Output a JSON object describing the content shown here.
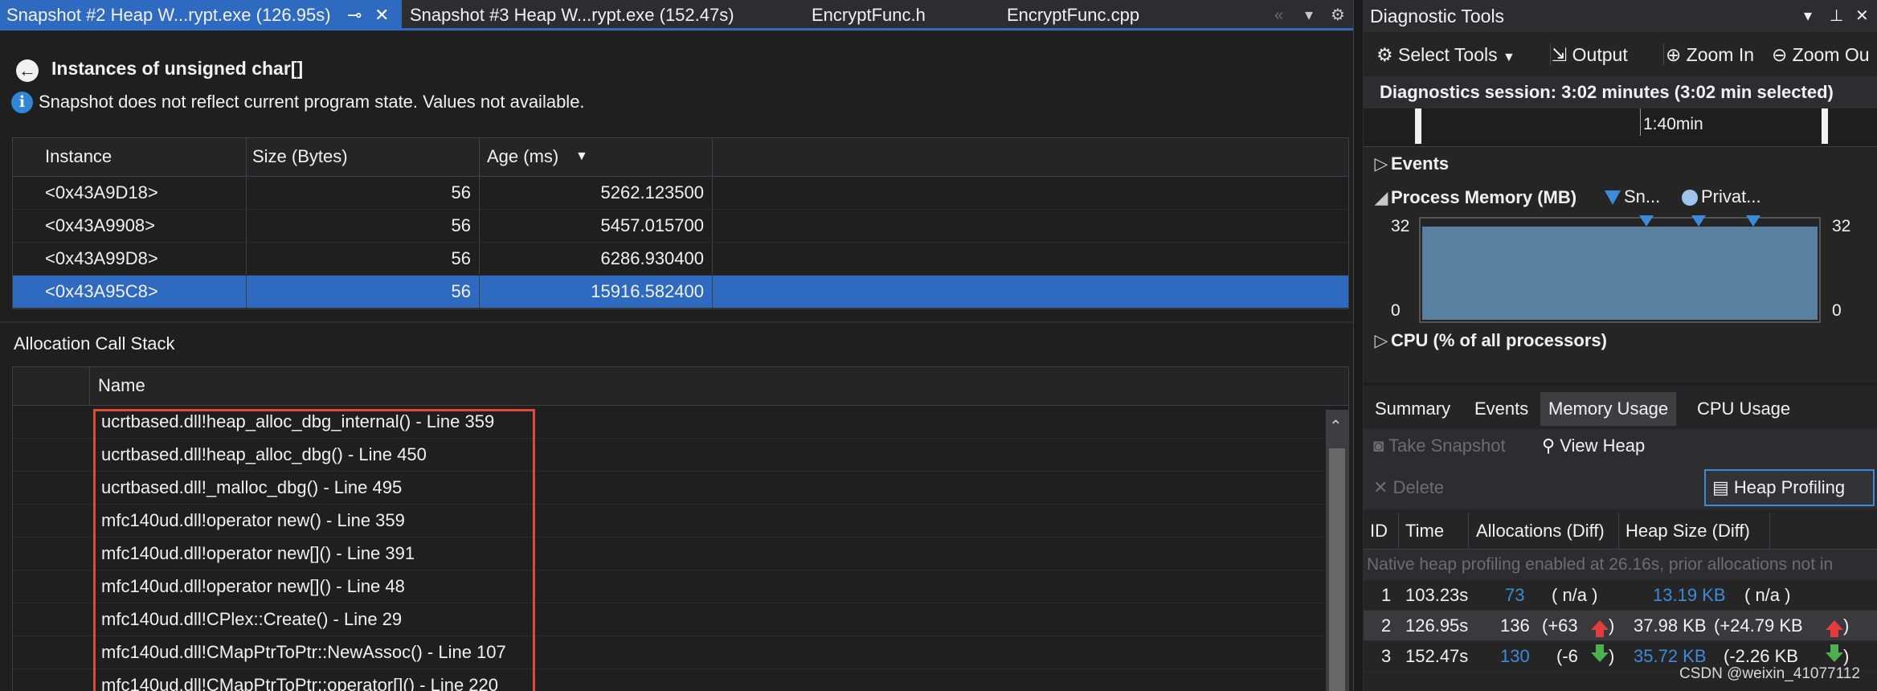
{
  "tabs": [
    {
      "label": "Snapshot #2 Heap W...rypt.exe (126.95s)",
      "active": true
    },
    {
      "label": "Snapshot #3 Heap W...rypt.exe (152.47s)",
      "active": false
    },
    {
      "label": "EncryptFunc.h",
      "active": false
    },
    {
      "label": "EncryptFunc.cpp",
      "active": false
    }
  ],
  "page": {
    "title": "Instances of unsigned char[]",
    "info": "Snapshot does not reflect current program state. Values not available."
  },
  "instances": {
    "columns": [
      "Instance",
      "Size (Bytes)",
      "Age (ms)"
    ],
    "rows": [
      {
        "instance": "<0x43A9D18>",
        "size": "56",
        "age": "5262.123500"
      },
      {
        "instance": "<0x43A9908>",
        "size": "56",
        "age": "5457.015700"
      },
      {
        "instance": "<0x43A99D8>",
        "size": "56",
        "age": "6286.930400"
      },
      {
        "instance": "<0x43A95C8>",
        "size": "56",
        "age": "15916.582400"
      }
    ],
    "selected_index": 3
  },
  "callstack": {
    "label": "Allocation Call Stack",
    "column": "Name",
    "frames": [
      "ucrtbased.dll!heap_alloc_dbg_internal() - Line 359",
      "ucrtbased.dll!heap_alloc_dbg() - Line 450",
      "ucrtbased.dll!_malloc_dbg() - Line 495",
      "mfc140ud.dll!operator new() - Line 359",
      "mfc140ud.dll!operator new[]() - Line 391",
      "mfc140ud.dll!operator new[]() - Line 48",
      "mfc140ud.dll!CPlex::Create() - Line 29",
      "mfc140ud.dll!CMapPtrToPtr::NewAssoc() - Line 107",
      "mfc140ud.dll!CMapPtrToPtr::operator[]() - Line 220"
    ]
  },
  "diag": {
    "title": "Diagnostic Tools",
    "toolbar": {
      "select_tools": "Select Tools",
      "output": "Output",
      "zoom_in": "Zoom In",
      "zoom_out": "Zoom Ou"
    },
    "session": "Diagnostics session: 3:02 minutes (3:02 min selected)",
    "ruler_label": "1:40min",
    "events": "Events",
    "process_memory": "Process Memory (MB)",
    "legend_snapshot": "Sn...",
    "legend_private": "Privat...",
    "mem_max": "32",
    "mem_min": "0",
    "cpu": "CPU (% of all processors)",
    "tabs": [
      "Summary",
      "Events",
      "Memory Usage",
      "CPU Usage"
    ],
    "active_tab": "Memory Usage",
    "take_snapshot": "Take Snapshot",
    "view_heap": "View Heap",
    "delete": "Delete",
    "heap_profiling": "Heap Profiling",
    "snap_columns": [
      "ID",
      "Time",
      "Allocations (Diff)",
      "Heap Size (Diff)"
    ],
    "note": "Native heap profiling enabled at 26.16s, prior allocations not in",
    "snapshots": [
      {
        "id": "1",
        "time": "103.23s",
        "alloc": "73",
        "alloc_diff": "( n/a )",
        "heap": "13.19 KB",
        "heap_diff": "( n/a )"
      },
      {
        "id": "2",
        "time": "126.95s",
        "alloc": "136",
        "alloc_diff": "(+63",
        "heap": "37.98 KB",
        "heap_diff": "(+24.79 KB"
      },
      {
        "id": "3",
        "time": "152.47s",
        "alloc": "130",
        "alloc_diff": "(-6",
        "heap": "35.72 KB",
        "heap_diff": "(-2.26 KB"
      }
    ]
  },
  "watermark": "CSDN @weixin_41077112"
}
